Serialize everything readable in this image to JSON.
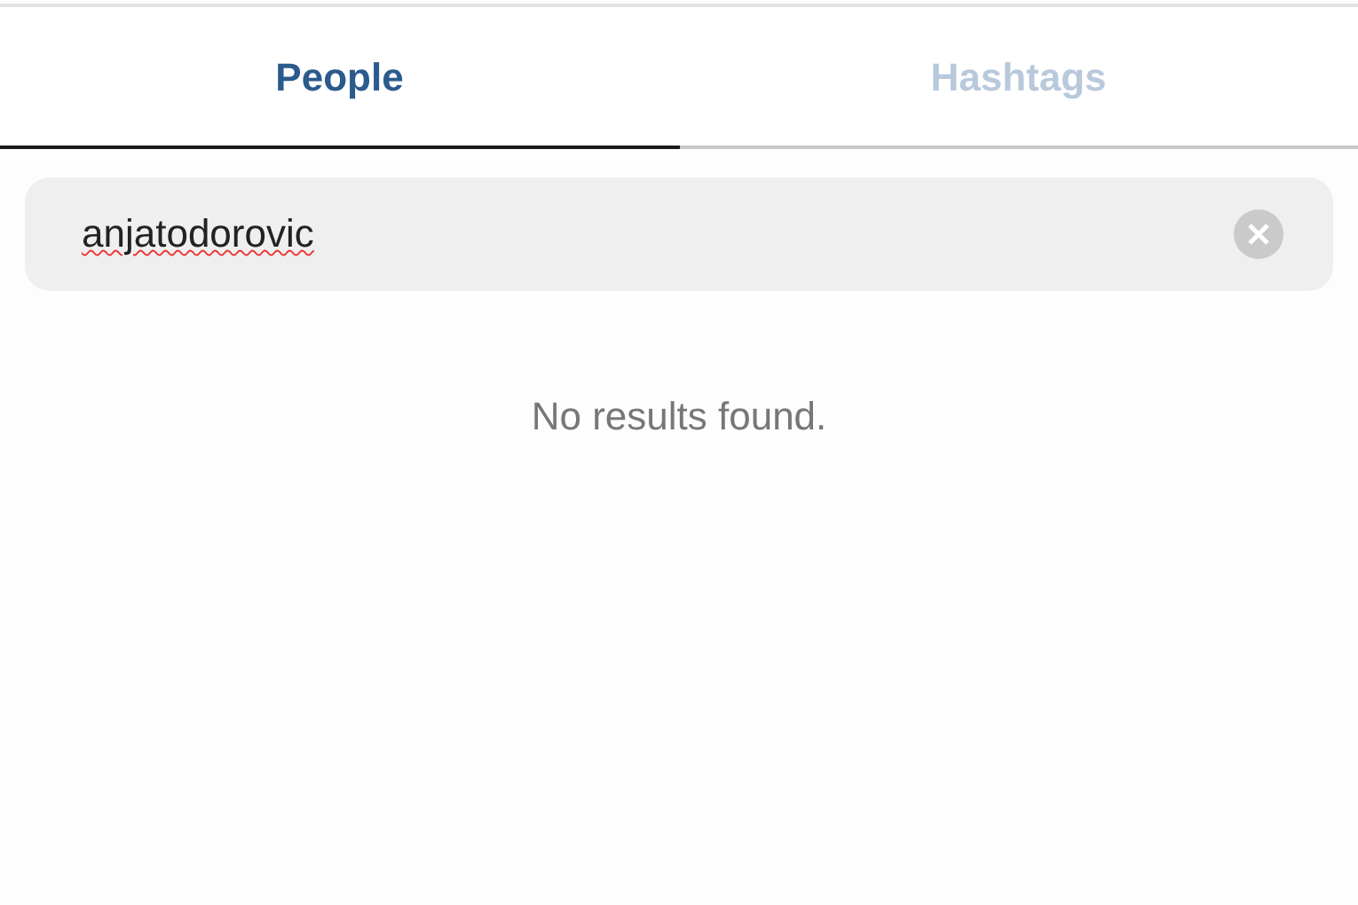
{
  "tabs": [
    {
      "label": "People",
      "selected": true
    },
    {
      "label": "Hashtags",
      "selected": false
    }
  ],
  "search": {
    "value": "anjatodorovic"
  },
  "message": "No results found."
}
